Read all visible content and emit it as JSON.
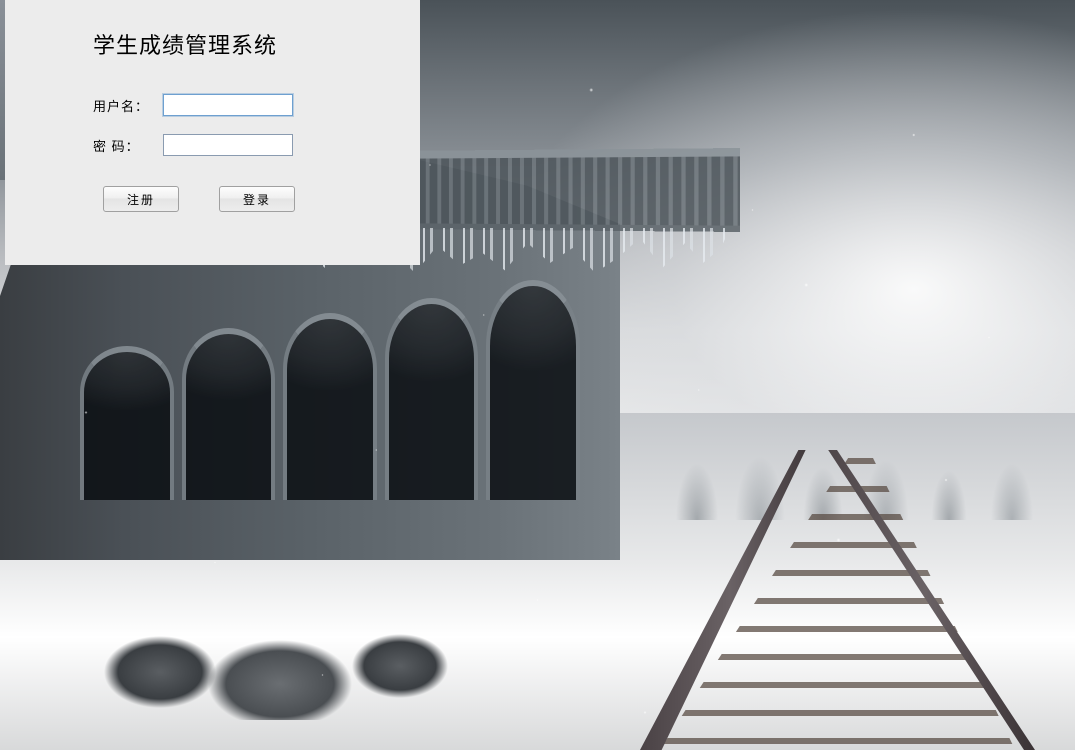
{
  "login": {
    "title": "学生成绩管理系统",
    "username_label": "用户名：",
    "username_value": "",
    "password_label": "密  码：",
    "password_value": "",
    "register_button": "注册",
    "login_button": "登录"
  }
}
